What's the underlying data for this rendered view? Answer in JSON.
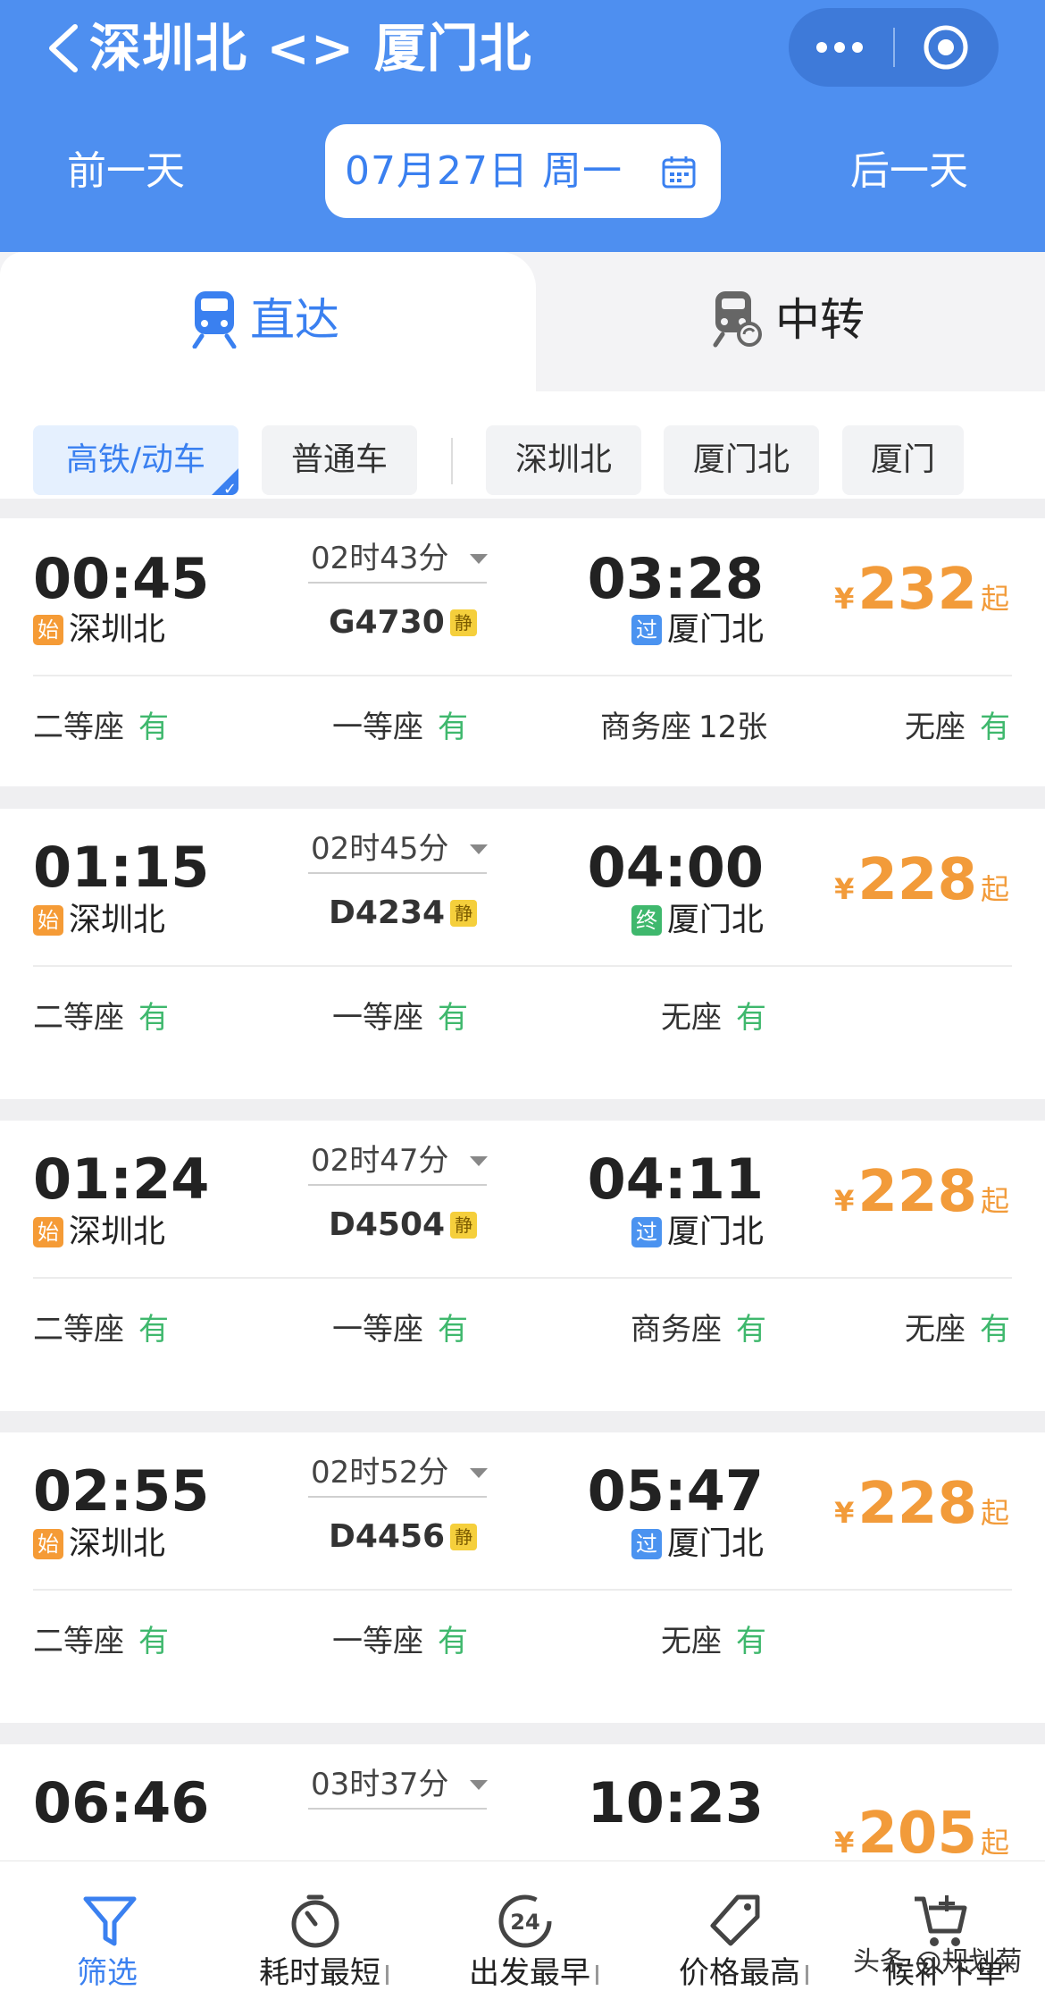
{
  "header": {
    "title": "深圳北 <> 厦门北",
    "prev_day": "前一天",
    "next_day": "后一天",
    "date": "07月27日  周一",
    "bg_color": "#4e8ff0",
    "accent_color": "#3a80f0"
  },
  "tabs": [
    {
      "label": "直达",
      "icon": "train-icon",
      "active": true
    },
    {
      "label": "中转",
      "icon": "transfer-train-icon",
      "active": false
    }
  ],
  "filters": {
    "train_types": [
      {
        "label": "高铁/动车",
        "selected": true
      },
      {
        "label": "普通车",
        "selected": false
      }
    ],
    "stations": [
      "深圳北",
      "厦门北",
      "厦门"
    ]
  },
  "trains": [
    {
      "dep_time": "00:45",
      "dep_badge": "始",
      "dep_station": "深圳北",
      "duration": "02时43分",
      "train_no": "G4730",
      "quiet_tag": "静",
      "arr_time": "03:28",
      "arr_badge": "过",
      "arr_station": "厦门北",
      "price_symbol": "¥",
      "price": "232",
      "price_suffix": "起",
      "seats": [
        {
          "name": "二等座",
          "status": "有"
        },
        {
          "name": "一等座",
          "status": "有"
        },
        {
          "name": "商务座",
          "status": "12张"
        },
        {
          "name": "无座",
          "status": "有"
        }
      ]
    },
    {
      "dep_time": "01:15",
      "dep_badge": "始",
      "dep_station": "深圳北",
      "duration": "02时45分",
      "train_no": "D4234",
      "quiet_tag": "静",
      "arr_time": "04:00",
      "arr_badge": "终",
      "arr_station": "厦门北",
      "price_symbol": "¥",
      "price": "228",
      "price_suffix": "起",
      "seats": [
        {
          "name": "二等座",
          "status": "有"
        },
        {
          "name": "一等座",
          "status": "有"
        },
        {
          "name": "无座",
          "status": "有"
        }
      ]
    },
    {
      "dep_time": "01:24",
      "dep_badge": "始",
      "dep_station": "深圳北",
      "duration": "02时47分",
      "train_no": "D4504",
      "quiet_tag": "静",
      "arr_time": "04:11",
      "arr_badge": "过",
      "arr_station": "厦门北",
      "price_symbol": "¥",
      "price": "228",
      "price_suffix": "起",
      "seats": [
        {
          "name": "二等座",
          "status": "有"
        },
        {
          "name": "一等座",
          "status": "有"
        },
        {
          "name": "商务座",
          "status": "有"
        },
        {
          "name": "无座",
          "status": "有"
        }
      ]
    },
    {
      "dep_time": "02:55",
      "dep_badge": "始",
      "dep_station": "深圳北",
      "duration": "02时52分",
      "train_no": "D4456",
      "quiet_tag": "静",
      "arr_time": "05:47",
      "arr_badge": "过",
      "arr_station": "厦门北",
      "price_symbol": "¥",
      "price": "228",
      "price_suffix": "起",
      "seats": [
        {
          "name": "二等座",
          "status": "有"
        },
        {
          "name": "一等座",
          "status": "有"
        },
        {
          "name": "无座",
          "status": "有"
        }
      ]
    },
    {
      "dep_time": "06:46",
      "duration": "03时37分",
      "arr_time": "10:23",
      "price_symbol": "¥",
      "price": "205",
      "price_suffix": "起"
    }
  ],
  "bottom_nav": [
    {
      "label": "筛选",
      "icon": "filter-icon",
      "active": true
    },
    {
      "label": "耗时最短",
      "icon": "timer-icon",
      "active": false
    },
    {
      "label": "出发最早",
      "icon": "clock-24-icon",
      "active": false
    },
    {
      "label": "价格最高",
      "icon": "price-tag-icon",
      "active": false
    },
    {
      "label": "候补下单",
      "icon": "cart-add-icon",
      "active": false
    }
  ],
  "watermark": "头条 @规划菊",
  "colors": {
    "price": "#f29b3a",
    "available": "#3fb86d",
    "badge_start": "#f59b36",
    "badge_pass": "#4b93f0",
    "badge_end": "#3fb86d",
    "quiet_tag": "#f5cf3c"
  }
}
